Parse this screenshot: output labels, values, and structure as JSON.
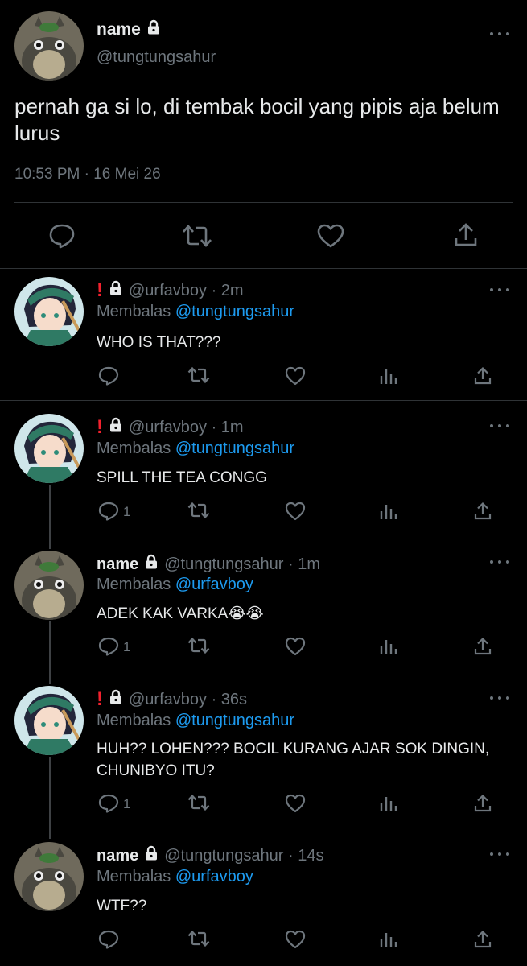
{
  "main_tweet": {
    "name": "name",
    "handle": "@tungtungsahur",
    "text": "pernah ga si lo, di tembak bocil yang pipis aja belum lurus",
    "timestamp": "10:53 PM · 16 Mei 26"
  },
  "replies": [
    {
      "name": "",
      "handle": "@urfavboy · 2m",
      "reply_prefix": "Membalas",
      "reply_to": "@tungtungsahur",
      "text": "WHO IS THAT???",
      "reply_count": ""
    },
    {
      "name": "",
      "handle": "@urfavboy · 1m",
      "reply_prefix": "Membalas",
      "reply_to": "@tungtungsahur",
      "text": "SPILL THE TEA CONGG",
      "reply_count": "1"
    },
    {
      "name": "name",
      "handle": "@tungtungsahur · 1m",
      "reply_prefix": "Membalas",
      "reply_to": "@urfavboy",
      "text": "ADEK KAK VARKA😭😭",
      "reply_count": "1"
    },
    {
      "name": "",
      "handle": "@urfavboy · 36s",
      "reply_prefix": "Membalas",
      "reply_to": "@tungtungsahur",
      "text": "HUH?? LOHEN??? BOCIL KURANG AJAR SOK DINGIN, CHUNIBYO ITU?",
      "reply_count": "1"
    },
    {
      "name": "name",
      "handle": "@tungtungsahur · 14s",
      "reply_prefix": "Membalas",
      "reply_to": "@urfavboy",
      "text": "WTF??",
      "reply_count": ""
    }
  ],
  "icons": {
    "lock": "lock-icon",
    "alert": "exclamation-icon",
    "reply": "reply-icon",
    "retweet": "retweet-icon",
    "like": "heart-icon",
    "analytics": "analytics-icon",
    "share": "share-icon",
    "more": "more-icon"
  },
  "colors": {
    "background": "#000000",
    "text": "#e7e9ea",
    "muted": "#6e767d",
    "link": "#1d9bf0",
    "alert": "#f4212e"
  }
}
